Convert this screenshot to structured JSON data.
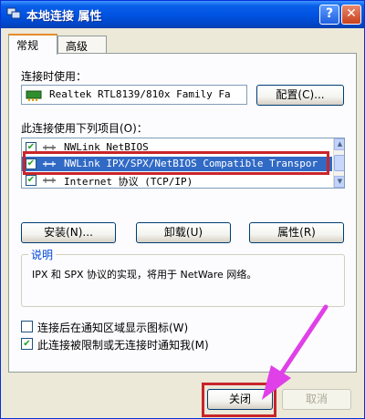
{
  "window": {
    "title": "本地连接 属性",
    "help_button": "?",
    "close_button": "✕"
  },
  "tabs": [
    {
      "label": "常规",
      "active": true
    },
    {
      "label": "高级",
      "active": false
    }
  ],
  "general": {
    "connect_using_label": "连接时使用：",
    "adapter_name": "Realtek RTL8139/810x Family Fa",
    "configure_button": "配置(C)...",
    "items_label": "此连接使用下列项目(O)：",
    "items": [
      {
        "label": "NWLink NetBIOS",
        "checked": true,
        "selected": false
      },
      {
        "label": "NWLink IPX/SPX/NetBIOS Compatible Transpor",
        "checked": true,
        "selected": true
      },
      {
        "label": "Internet 协议 (TCP/IP)",
        "checked": true,
        "selected": false
      }
    ],
    "install_button": "安装(N)...",
    "uninstall_button": "卸载(U)",
    "properties_button": "属性(R)",
    "description_title": "说明",
    "description_text": "IPX 和 SPX 协议的实现，将用于 NetWare 网络。",
    "option_tray_icon": "连接后在通知区域显示图标(W)",
    "option_tray_icon_checked": false,
    "option_notify_limited": "此连接被限制或无连接时通知我(M)",
    "option_notify_limited_checked": true
  },
  "footer": {
    "close_button": "关闭",
    "cancel_button": "取消"
  },
  "colors": {
    "title_bar": "#0054e3",
    "highlight": "#c9252a",
    "selection": "#316ac5",
    "annotation_arrow": "#e040e8"
  }
}
